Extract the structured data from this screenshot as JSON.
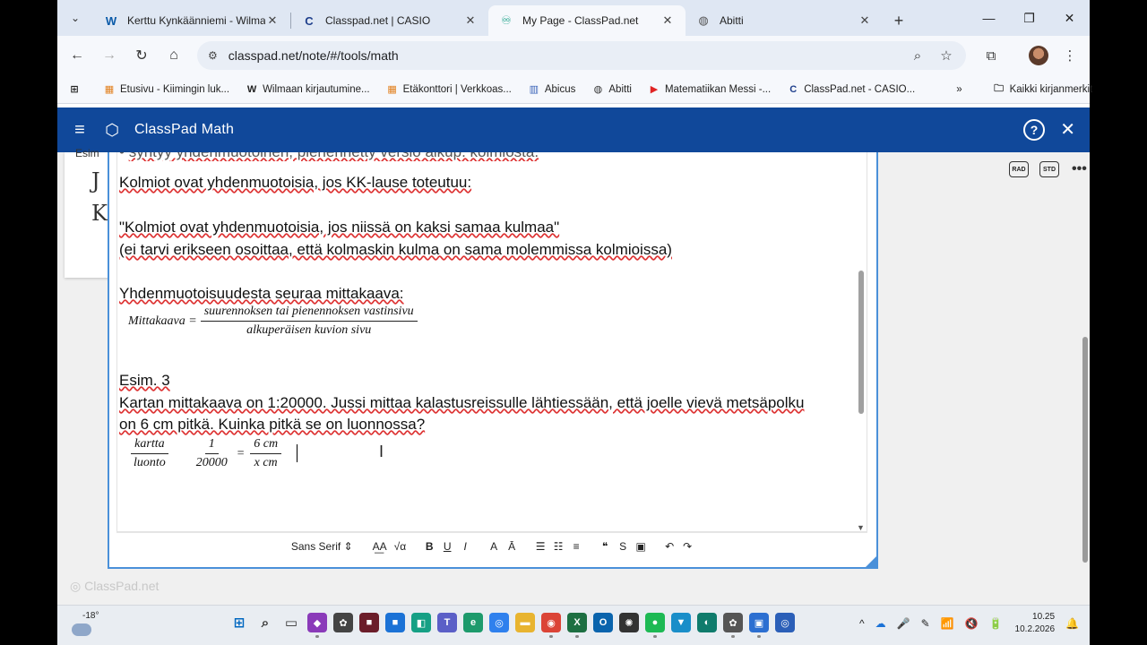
{
  "browser": {
    "tabs": [
      {
        "title": "Kerttu Kynkäänniemi - Wilma",
        "icon": "W",
        "active": false
      },
      {
        "title": "Classpad.net | CASIO",
        "icon": "C",
        "active": false
      },
      {
        "title": "My Page - ClassPad.net",
        "icon": "♾",
        "active": true
      },
      {
        "title": "Abitti",
        "icon": "◍",
        "active": false
      }
    ],
    "close_glyph": "✕",
    "new_tab": "+",
    "url": "classpad.net/note/#/tools/math",
    "bookmarks": [
      {
        "label": "Etusivu - Kiimingin luk...",
        "icon": "▦",
        "color": "#e2801e"
      },
      {
        "label": "Wilmaan kirjautumine...",
        "icon": "W",
        "color": "#222222"
      },
      {
        "label": "Etäkonttori | Verkkoas...",
        "icon": "▦",
        "color": "#e2801e"
      },
      {
        "label": "Abicus",
        "icon": "▥",
        "color": "#3a63b8"
      },
      {
        "label": "Abitti",
        "icon": "◍",
        "color": "#333333"
      },
      {
        "label": "Matematiikan Messi -...",
        "icon": "▶",
        "color": "#e02424"
      },
      {
        "label": "ClassPad.net - CASIO...",
        "icon": "C",
        "color": "#1f3f8c"
      }
    ],
    "bookmarks_overflow": "»",
    "all_bookmarks": "Kaikki kirjanmerkit"
  },
  "app": {
    "title": "ClassPad Math",
    "header_color": "#10489a",
    "help": "?",
    "close": "✕"
  },
  "workspace": {
    "bg_note_label": "Esim",
    "bg_note_big": [
      "J",
      "K"
    ],
    "watermark": "ClassPad.net",
    "rad_label": "RAD",
    "std_label": "STD",
    "more": "•••"
  },
  "editor": {
    "line_kk": "Kolmiot ovat yhdenmuotoisia, jos KK-lause toteutuu:",
    "line_quote": "\"Kolmiot ovat yhdenmuotoisia, jos niissä on kaksi samaa kulmaa\"",
    "line_paren": "(ei tarvi erikseen osoittaa, että kolmaskin kulma on sama molemmissa kolmioissa)",
    "line_scale": "Yhdenmuotoisuudesta seuraa mittakaava:",
    "formula": {
      "lhs": "Mittakaava =",
      "num": "suurennoksen tai pienennoksen vastinsivu",
      "den": "alkuperäisen kuvion sivu"
    },
    "example_title": "Esim. 3",
    "example_line1": "Kartan mittakaava on 1:20000. Jussi mittaa kalastusreissulle lähtiessään, että joelle vievä metsäpolku",
    "example_line2": "on 6 cm pitkä. Kuinka pitkä se on luonnossa?",
    "eq": {
      "f1_num": "kartta",
      "f1_den": "luonto",
      "f2_num": "1",
      "f2_den": "20000",
      "equals": "=",
      "f3_num": "6 cm",
      "f3_den": "x cm"
    }
  },
  "toolbar": {
    "font": "Sans Serif",
    "items": [
      "A͟A",
      "√α",
      "B",
      "U",
      "I",
      "A",
      "Ā",
      "☰",
      "☷",
      "≡",
      "❝",
      "S",
      "▣",
      "↶",
      "↷"
    ]
  },
  "taskbar": {
    "temperature": "-18°",
    "time": "10.25",
    "date": "10.2.2026",
    "apps": [
      {
        "name": "start",
        "glyph": "⊞",
        "color": "#0067c0"
      },
      {
        "name": "search",
        "glyph": "⌕",
        "color": "#333333"
      },
      {
        "name": "task-view",
        "glyph": "▭",
        "color": "#333333"
      },
      {
        "name": "app-purple",
        "glyph": "◆",
        "color": "#8a3ab9"
      },
      {
        "name": "app-gear",
        "glyph": "✿",
        "color": "#444444"
      },
      {
        "name": "app-dark",
        "glyph": "■",
        "color": "#6b1d2a"
      },
      {
        "name": "app-blue",
        "glyph": "■",
        "color": "#1b72d6"
      },
      {
        "name": "app-teal",
        "glyph": "◧",
        "color": "#16a085"
      },
      {
        "name": "app-teams",
        "glyph": "T",
        "color": "#5b5fc7"
      },
      {
        "name": "app-edge",
        "glyph": "e",
        "color": "#1d9a6c"
      },
      {
        "name": "app-browser",
        "glyph": "◎",
        "color": "#2f80ed"
      },
      {
        "name": "file-explorer",
        "glyph": "▬",
        "color": "#e8b430"
      },
      {
        "name": "chrome",
        "glyph": "◉",
        "color": "#db4437"
      },
      {
        "name": "excel",
        "glyph": "X",
        "color": "#1d6f42"
      },
      {
        "name": "outlook",
        "glyph": "O",
        "color": "#0a64ad"
      },
      {
        "name": "chatgpt",
        "glyph": "✺",
        "color": "#333333"
      },
      {
        "name": "spotify",
        "glyph": "●",
        "color": "#1db954"
      },
      {
        "name": "app-cyan",
        "glyph": "▼",
        "color": "#1a8ec9"
      },
      {
        "name": "app-ring",
        "glyph": "◐",
        "color": "#0f7b6c"
      },
      {
        "name": "app-gear2",
        "glyph": "✿",
        "color": "#555555"
      },
      {
        "name": "app-store",
        "glyph": "▣",
        "color": "#2c6fd1"
      },
      {
        "name": "app-circle",
        "glyph": "◎",
        "color": "#2b5fb8"
      }
    ],
    "tray": [
      "^",
      "☁",
      "🎤",
      "✎",
      "📶",
      "🔇",
      "🔋"
    ]
  }
}
